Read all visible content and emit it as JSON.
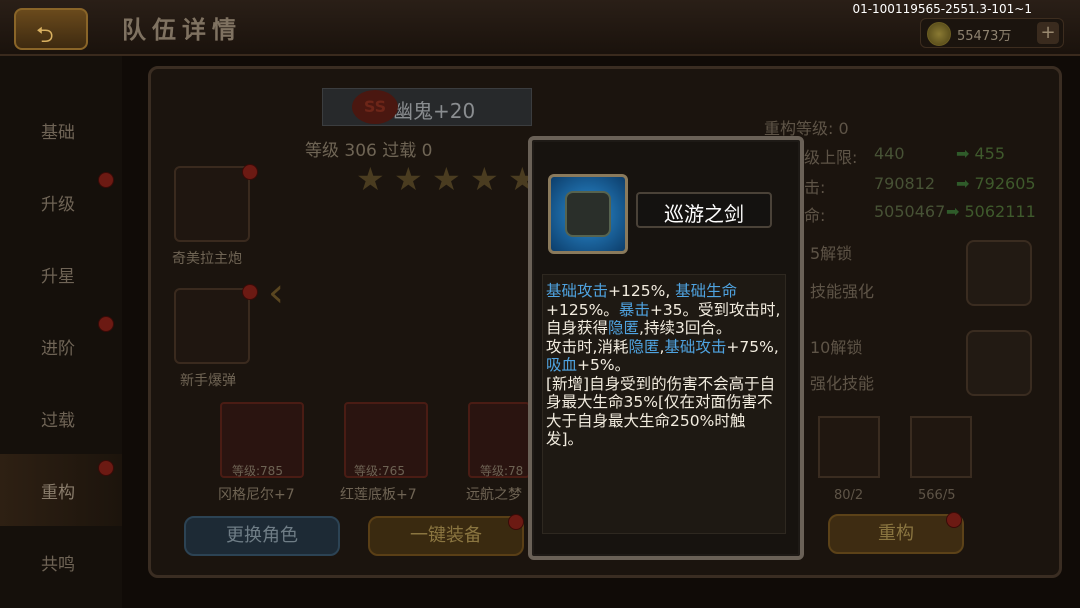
{
  "header": {
    "title": "队伍详情",
    "build_id": "01-100119565-2551.3-101~1",
    "coins": "55473万",
    "coin_plus": "+",
    "back": "⮌"
  },
  "sidebar": {
    "items": [
      "基础",
      "升级",
      "升星",
      "进阶",
      "过载",
      "重构",
      "共鸣"
    ],
    "active_index": 5
  },
  "hero": {
    "badge": "SS",
    "name": "幽鬼+20",
    "level_line": "等级 306  过载 0",
    "stars": 5
  },
  "equipment": [
    {
      "name": "奇美拉主炮"
    },
    {
      "name": "新手爆弹"
    }
  ],
  "team_cards": [
    {
      "level": "等级:785",
      "name": "冈格尼尔+7"
    },
    {
      "level": "等级:765",
      "name": "红莲底板+7"
    },
    {
      "level": "等级:78",
      "name": "远航之梦"
    }
  ],
  "buttons": {
    "swap": "更换角色",
    "equip": "一键装备",
    "rebuild": "重构"
  },
  "stats": {
    "rebuild_level": "重构等级: 0",
    "rows": [
      {
        "label": "级上限:",
        "value": "440",
        "new": "455"
      },
      {
        "label": "击:",
        "value": "790812",
        "new": "792605"
      },
      {
        "label": "命:",
        "value": "5050467",
        "new": "5062111"
      }
    ],
    "unlocks": [
      "5解锁",
      "技能强化",
      "10解锁",
      "强化技能"
    ],
    "materials": [
      {
        "count": "80/2"
      },
      {
        "count": "566/5"
      }
    ]
  },
  "tooltip": {
    "title": "巡游之剑",
    "icon": "gauntlet-icon",
    "desc": [
      [
        {
          "t": "基础攻击",
          "k": true
        },
        {
          "t": "+125%, "
        },
        {
          "t": "基础生命",
          "k": true
        },
        {
          "t": "+125%。"
        },
        {
          "t": "暴击",
          "k": true
        },
        {
          "t": "+35。受到攻击时,自身获得"
        },
        {
          "t": "隐匿",
          "k": true
        },
        {
          "t": ",持续3回合。"
        }
      ],
      [
        {
          "t": "攻击时,消耗"
        },
        {
          "t": "隐匿",
          "k": true
        },
        {
          "t": ","
        },
        {
          "t": "基础攻击",
          "k": true
        },
        {
          "t": "+75%,"
        },
        {
          "t": "吸血",
          "k": true
        },
        {
          "t": "+5%。"
        }
      ],
      [
        {
          "t": "[新增]自身受到的伤害不会高于自身最大生命35%[仅在对面伤害不大于自身最大生命250%时触发]。"
        }
      ]
    ]
  },
  "colors": {
    "keyword": "#4fa3e0",
    "text": "#f2ecdf",
    "title": "#ffffff"
  }
}
